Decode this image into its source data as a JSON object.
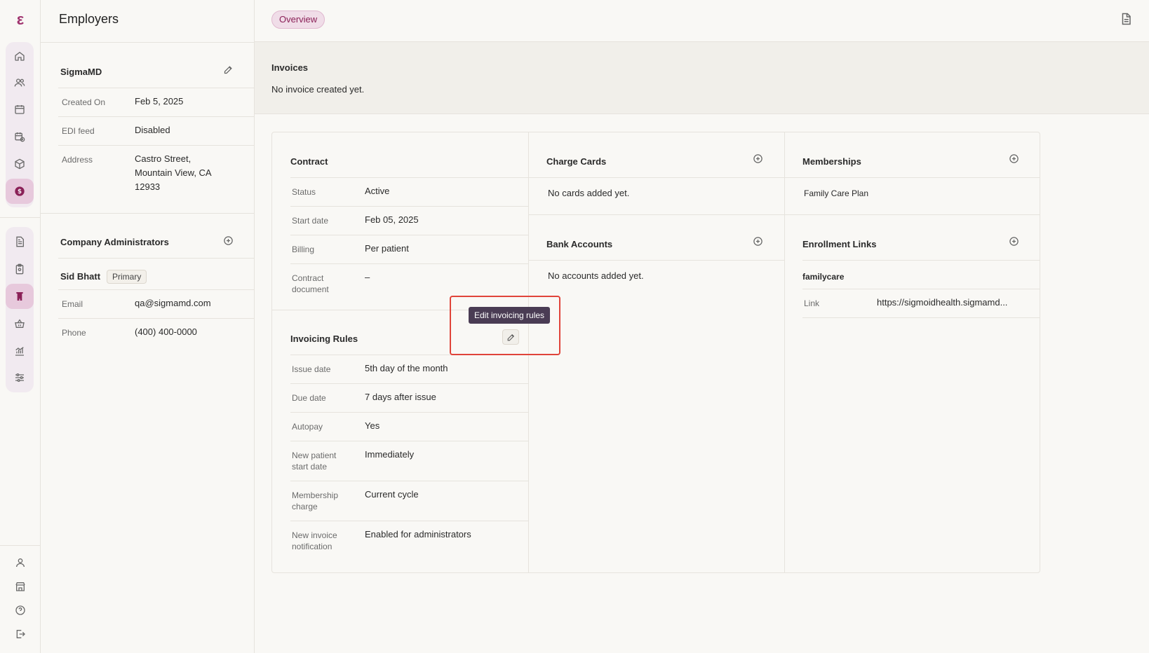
{
  "app": {
    "logo_glyph": "ε",
    "accent_color": "#8a2057",
    "highlight_color": "#e0443a"
  },
  "rail": {
    "group1": [
      {
        "icon": "home-icon"
      },
      {
        "icon": "users-icon"
      },
      {
        "icon": "calendar-icon"
      },
      {
        "icon": "calendar-check-icon"
      },
      {
        "icon": "package-icon"
      },
      {
        "icon": "dollar-icon",
        "active": true
      }
    ],
    "group2": [
      {
        "icon": "file-text-icon"
      },
      {
        "icon": "clipboard-icon"
      },
      {
        "icon": "building-icon",
        "active": true
      },
      {
        "icon": "basket-icon"
      },
      {
        "icon": "chart-icon"
      },
      {
        "icon": "sliders-icon"
      }
    ],
    "bottom": [
      {
        "icon": "user-icon"
      },
      {
        "icon": "store-icon"
      },
      {
        "icon": "help-icon"
      },
      {
        "icon": "logout-icon"
      }
    ]
  },
  "left": {
    "page_title": "Employers",
    "employer": {
      "name": "SigmaMD",
      "created_on_label": "Created On",
      "created_on": "Feb 5, 2025",
      "edi_label": "EDI feed",
      "edi": "Disabled",
      "address_label": "Address",
      "address_line1": "Castro Street,",
      "address_line2": "Mountain View, CA",
      "address_line3": "12933"
    },
    "admins": {
      "title": "Company Administrators",
      "name": "Sid Bhatt",
      "badge": "Primary",
      "email_label": "Email",
      "email": "qa@sigmamd.com",
      "phone_label": "Phone",
      "phone": "(400) 400-0000"
    }
  },
  "main": {
    "tab": "Overview",
    "invoices": {
      "title": "Invoices",
      "empty": "No invoice created yet."
    },
    "contract": {
      "title": "Contract",
      "rows": [
        {
          "label": "Status",
          "value": "Active"
        },
        {
          "label": "Start date",
          "value": "Feb 05, 2025"
        },
        {
          "label": "Billing",
          "value": "Per patient"
        },
        {
          "label1": "Contract",
          "label2": "document",
          "value": "–"
        }
      ]
    },
    "invoicing": {
      "title": "Invoicing Rules",
      "tooltip": "Edit invoicing rules",
      "rows": [
        {
          "label": "Issue date",
          "value": "5th day of the month"
        },
        {
          "label": "Due date",
          "value": "7 days after issue"
        },
        {
          "label": "Autopay",
          "value": "Yes"
        },
        {
          "label1": "New patient",
          "label2": "start date",
          "value": "Immediately"
        },
        {
          "label1": "Membership",
          "label2": "charge",
          "value": "Current cycle"
        },
        {
          "label1": "New invoice",
          "label2": "notification",
          "value": "Enabled for administrators"
        }
      ]
    },
    "charge_cards": {
      "title": "Charge Cards",
      "empty": "No cards added yet."
    },
    "bank_accounts": {
      "title": "Bank Accounts",
      "empty": "No accounts added yet."
    },
    "memberships": {
      "title": "Memberships",
      "item": "Family Care Plan"
    },
    "enrollment": {
      "title": "Enrollment Links",
      "item": "familycare",
      "link_label": "Link",
      "link_value": "https://sigmoidhealth.sigmamd..."
    }
  }
}
